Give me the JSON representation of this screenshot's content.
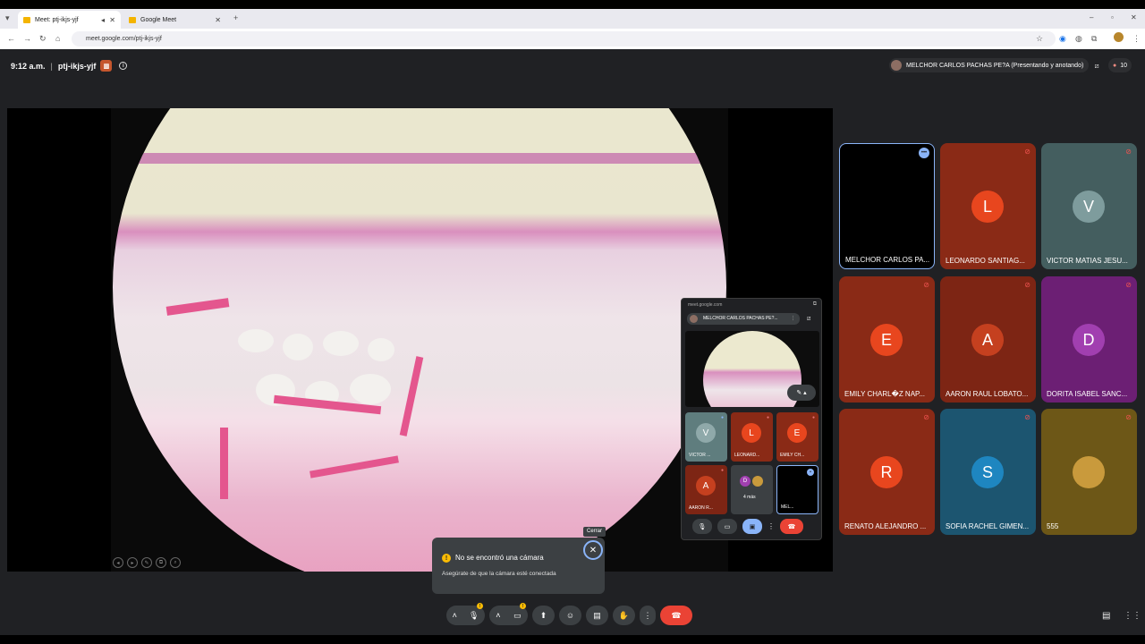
{
  "browser": {
    "tabs": [
      {
        "title": "Meet: ptj-ikjs-yjf",
        "active": true
      },
      {
        "title": "Google Meet",
        "active": false
      }
    ],
    "url": "meet.google.com/ptj-ikjs-yjf"
  },
  "meeting": {
    "time": "9:12 a.m.",
    "code": "ptj-ikjs-yjf",
    "presenter_chip": "MELCHOR CARLOS PACHAS PE?A (Presentando y anotando)",
    "participant_count": "10"
  },
  "pip": {
    "title": "meet.google.com",
    "chip": "MELCHOR CARLOS PACHAS PE?...",
    "tiles": [
      {
        "initial": "V",
        "label": "VICTOR ...",
        "color": "#5f7d7e"
      },
      {
        "initial": "L",
        "label": "LEONARD...",
        "color": "#c5401f"
      },
      {
        "initial": "E",
        "label": "EMILY CH...",
        "color": "#c5401f"
      },
      {
        "initial": "A",
        "label": "AARON R...",
        "color": "#c5401f"
      },
      {
        "initial": "D",
        "label": "4 más",
        "color": "#3c4043"
      },
      {
        "initial": "",
        "label": "MEL...",
        "color": "#000000"
      }
    ]
  },
  "participants": [
    {
      "name": "MELCHOR CARLOS PA...",
      "initial": "",
      "tile_color": "#000000",
      "avatar_color": "",
      "speaking": true
    },
    {
      "name": "LEONARDO SANTIAG...",
      "initial": "L",
      "tile_color": "#8a2a16",
      "avatar_color": "#e8461e",
      "speaking": false
    },
    {
      "name": "VICTOR MATIAS JESU...",
      "initial": "V",
      "tile_color": "#445e5f",
      "avatar_color": "#7e9c9d",
      "speaking": false
    },
    {
      "name": "EMILY CHARL�Z NAP...",
      "initial": "E",
      "tile_color": "#8a2a16",
      "avatar_color": "#e8461e",
      "speaking": false
    },
    {
      "name": "AARON RAUL LOBATO...",
      "initial": "A",
      "tile_color": "#7d2514",
      "avatar_color": "#c5401f",
      "speaking": false
    },
    {
      "name": "DORITA ISABEL SANC...",
      "initial": "D",
      "tile_color": "#6c1f74",
      "avatar_color": "#a13fb0",
      "speaking": false
    },
    {
      "name": "RENATO ALEJANDRO ...",
      "initial": "R",
      "tile_color": "#8a2a16",
      "avatar_color": "#e8461e",
      "speaking": false
    },
    {
      "name": "SOFIA RACHEL GIMEN...",
      "initial": "S",
      "tile_color": "#1c5570",
      "avatar_color": "#1e86c0",
      "speaking": false
    },
    {
      "name": "555",
      "initial": "",
      "tile_color": "#6d5717",
      "avatar_color": "#c99a3c",
      "speaking": false
    }
  ],
  "toast": {
    "tooltip": "Cerrar",
    "title": "No se encontró una cámara",
    "message": "Asegúrate de que la cámara esté conectada"
  },
  "colors": {
    "meet_bg": "#202124",
    "end_call": "#ea4335",
    "accent": "#8ab4f8",
    "warning": "#fbbc04"
  }
}
